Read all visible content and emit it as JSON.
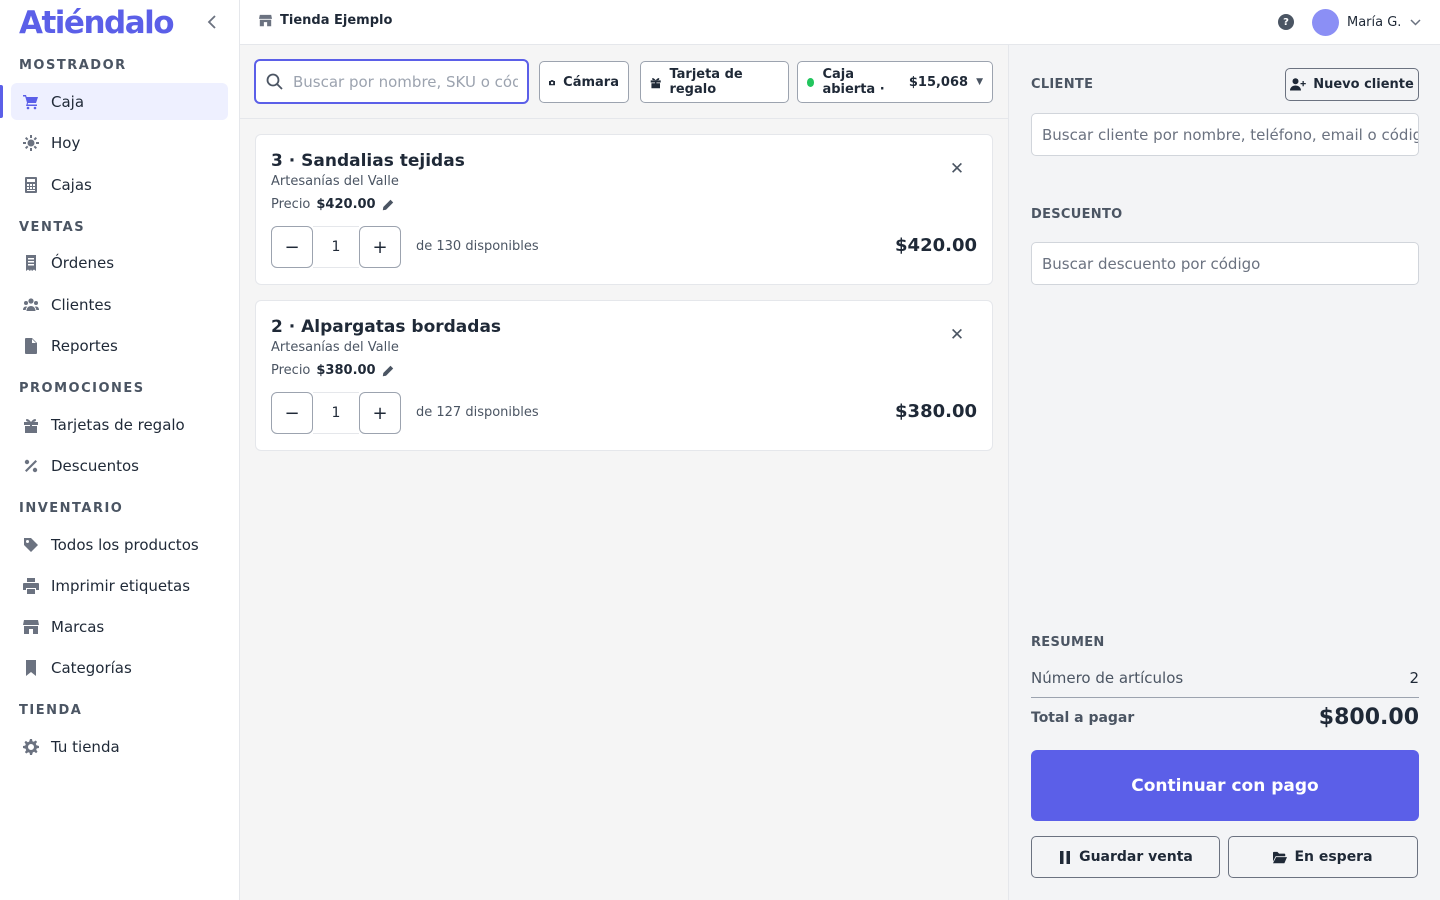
{
  "app": {
    "brand": "Atiéndalo"
  },
  "sidebar": {
    "sections": [
      {
        "title": "MOSTRADOR",
        "items": [
          {
            "label": "Caja",
            "icon": "cart-icon",
            "active": true
          },
          {
            "label": "Hoy",
            "icon": "sun-icon"
          },
          {
            "label": "Cajas",
            "icon": "calculator-icon"
          }
        ]
      },
      {
        "title": "VENTAS",
        "items": [
          {
            "label": "Órdenes",
            "icon": "receipt-icon"
          },
          {
            "label": "Clientes",
            "icon": "users-icon"
          },
          {
            "label": "Reportes",
            "icon": "file-icon"
          }
        ]
      },
      {
        "title": "PROMOCIONES",
        "items": [
          {
            "label": "Tarjetas de regalo",
            "icon": "gift-icon"
          },
          {
            "label": "Descuentos",
            "icon": "percent-icon"
          }
        ]
      },
      {
        "title": "INVENTARIO",
        "items": [
          {
            "label": "Todos los productos",
            "icon": "tag-icon"
          },
          {
            "label": "Imprimir etiquetas",
            "icon": "printer-icon"
          },
          {
            "label": "Marcas",
            "icon": "store-icon"
          },
          {
            "label": "Categorías",
            "icon": "bookmark-icon"
          }
        ]
      },
      {
        "title": "TIENDA",
        "items": [
          {
            "label": "Tu tienda",
            "icon": "gear-icon"
          }
        ]
      }
    ]
  },
  "header": {
    "store_name": "Tienda Ejemplo",
    "help_glyph": "?",
    "user_name": "María G."
  },
  "toolbar": {
    "search_placeholder": "Buscar por nombre, SKU o código",
    "camera_label": "Cámara",
    "giftcard_label": "Tarjeta de regalo",
    "register_status": "Caja abierta ·",
    "register_amount": "$15,068",
    "register_status_color": "#22c55e"
  },
  "cart": {
    "price_label": "Precio",
    "items": [
      {
        "title": "3 · Sandalias tejidas",
        "brand": "Artesanías del Valle",
        "price": "$420.00",
        "qty": "1",
        "available": "de 130 disponibles",
        "line_total": "$420.00"
      },
      {
        "title": "2 · Alpargatas bordadas",
        "brand": "Artesanías del Valle",
        "price": "$380.00",
        "qty": "1",
        "available": "de 127 disponibles",
        "line_total": "$380.00"
      }
    ]
  },
  "customer": {
    "label": "CLIENTE",
    "new_client_label": "Nuevo cliente",
    "search_placeholder": "Buscar cliente por nombre, teléfono, email o código"
  },
  "discount": {
    "label": "DESCUENTO",
    "search_placeholder": "Buscar descuento por código"
  },
  "summary": {
    "label": "RESUMEN",
    "items_label": "Número de artículos",
    "items_value": "2",
    "total_label": "Total a pagar",
    "total_value": "$800.00"
  },
  "actions": {
    "pay_label": "Continuar con pago",
    "save_label": "Guardar venta",
    "hold_label": "En espera"
  },
  "colors": {
    "accent": "#5b5fe8",
    "active_bg": "#eef0ff"
  }
}
